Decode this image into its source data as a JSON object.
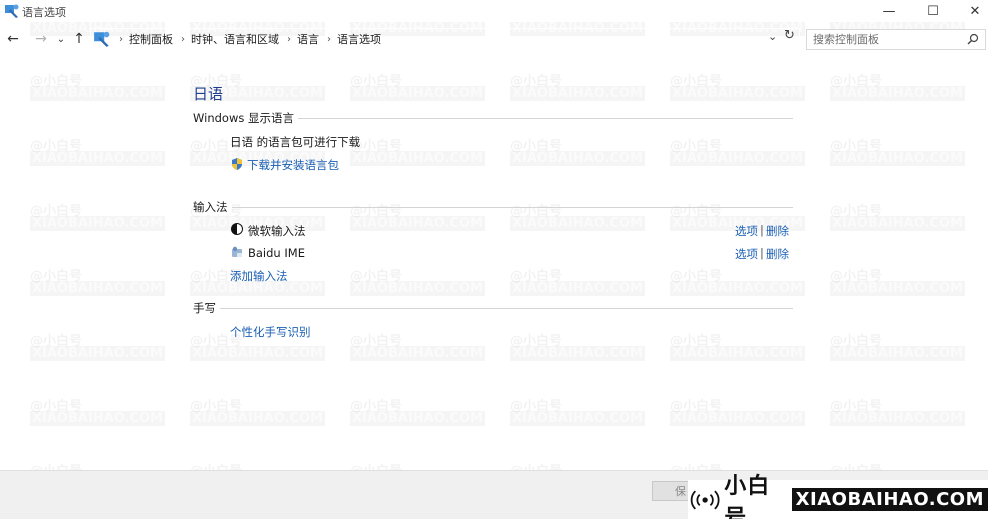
{
  "window": {
    "title": "语言选项",
    "minimize": "—",
    "maximize": "☐",
    "close": "✕"
  },
  "address": {
    "breadcrumbs": [
      "控制面板",
      "时钟、语言和区域",
      "语言",
      "语言选项"
    ],
    "search_placeholder": "搜索控制面板"
  },
  "main": {
    "heading": "日语",
    "display_language": {
      "title": "Windows 显示语言",
      "status": "日语 的语言包可进行下载",
      "download_link": "下载并安装语言包"
    },
    "input_methods": {
      "title": "输入法",
      "items": [
        {
          "name": "微软输入法",
          "options": "选项",
          "separator": "|",
          "remove": "删除"
        },
        {
          "name": "Baidu IME",
          "options": "选项",
          "separator": "|",
          "remove": "删除"
        }
      ],
      "add_link": "添加输入法"
    },
    "handwriting": {
      "title": "手写",
      "personalize_link": "个性化手写识别"
    }
  },
  "footer": {
    "save_label": "保"
  },
  "watermark": {
    "top": "@小白号",
    "bottom": "XIAOBAIHAO.COM"
  },
  "brand": {
    "cn": "小白号",
    "en": "XIAOBAIHAO.COM"
  },
  "colors": {
    "link": "#1a5fb4",
    "heading": "#1e3d8f"
  }
}
